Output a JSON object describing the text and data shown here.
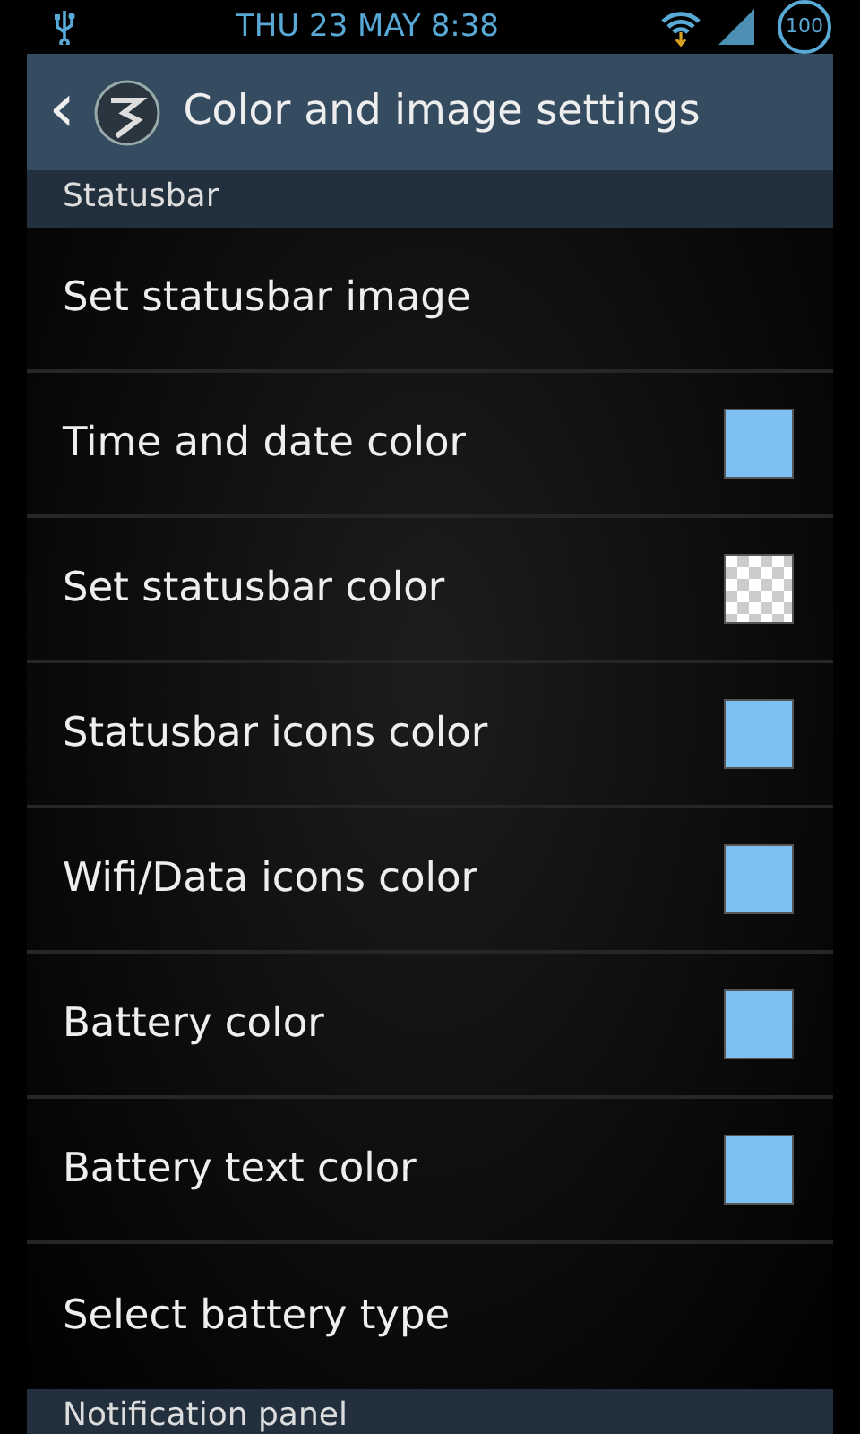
{
  "status_bar": {
    "time": "THU 23 MAY 8:38",
    "battery": "100"
  },
  "action_bar": {
    "back": "‹",
    "title": "Color and image settings"
  },
  "sections": [
    {
      "header": "Statusbar",
      "items": [
        {
          "label": "Set statusbar image",
          "kind": "plain"
        },
        {
          "label": "Time and date color",
          "kind": "swatch",
          "color": "#7dc1f3"
        },
        {
          "label": "Set statusbar color",
          "kind": "transparent"
        },
        {
          "label": "Statusbar icons color",
          "kind": "swatch",
          "color": "#7dc1f3"
        },
        {
          "label": "Wifi/Data icons color",
          "kind": "swatch",
          "color": "#7dc1f3"
        },
        {
          "label": "Battery color",
          "kind": "swatch",
          "color": "#7dc1f3"
        },
        {
          "label": "Battery text color",
          "kind": "swatch",
          "color": "#7dc1f3"
        },
        {
          "label": "Select battery type",
          "kind": "plain"
        }
      ]
    },
    {
      "header": "Notification panel"
    }
  ]
}
